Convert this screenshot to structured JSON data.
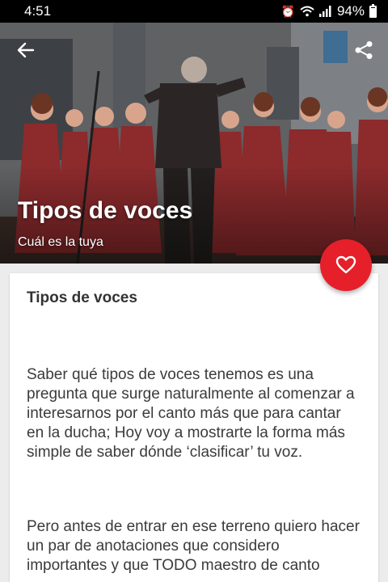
{
  "status_bar": {
    "time": "4:51",
    "battery": "94%"
  },
  "hero": {
    "title": "Tipos de voces",
    "subtitle": "Cuál es la tuya"
  },
  "article": {
    "heading": "Tipos de voces",
    "paragraphs": [
      "Saber qué tipos de voces tenemos es una pregunta que surge naturalmente al comenzar a interesarnos por el canto más que para cantar en la ducha; Hoy voy a mostrarte la forma más simple de saber dónde ‘clasificar’ tu voz.",
      "Pero antes de entrar en ese terreno quiero hacer un par de anotaciones que considero importantes y que TODO maestro de canto"
    ]
  },
  "colors": {
    "accent": "#e5202a",
    "status_bar_bg": "#000000",
    "choir_robe": "#8c2a2c"
  },
  "icons": {
    "back": "arrow-left-icon",
    "share": "share-icon",
    "favorite": "heart-icon"
  }
}
